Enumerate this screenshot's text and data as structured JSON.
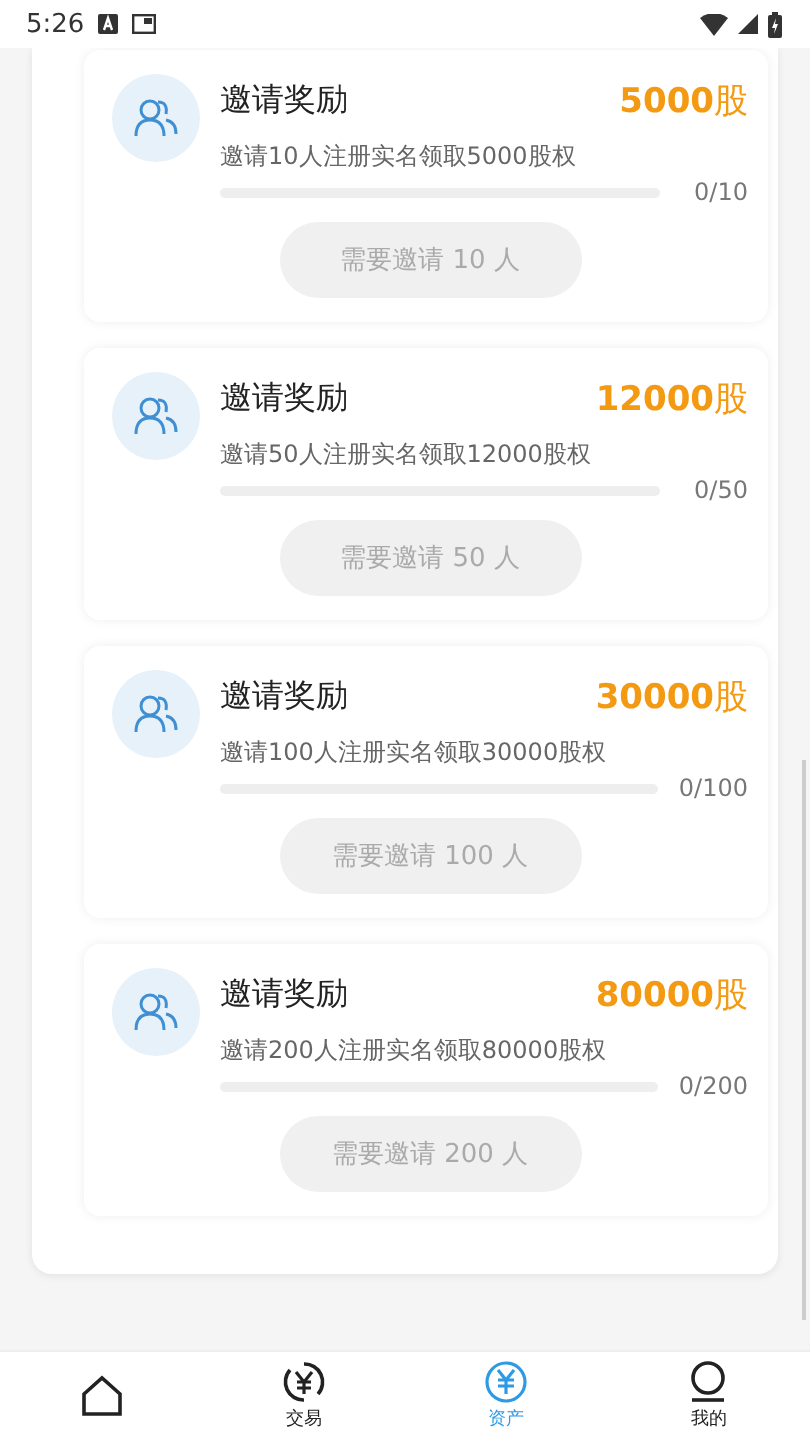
{
  "status_bar": {
    "time": "5:26"
  },
  "rewards": [
    {
      "title": "邀请奖励",
      "amount": "**5000**股",
      "description": "邀请10人注册实名领取5000股权",
      "level": 0,
      "count": "0/10",
      "button": "需要邀请 10 人",
      "disabled": true
    },
    {
      "title": "邀请奖励",
      "amount": "**12000**股",
      "description": "邀请50人注册实名领取12000股权",
      "level": 0,
      "count": "0/50",
      "button": "需要邀请 50 人",
      "disabled": true
    },
    {
      "title": "邀请奖励",
      "amount": "**30000**股",
      "description": "邀请100人注册实名领取30000股权",
      "level": 0,
      "count": "0/100",
      "button": "需要邀请 100 人",
      "disabled": true
    },
    {
      "title": "邀请奖励",
      "amount": "**80000**股",
      "description": "邀请200人注册实名领取80000股权",
      "level": 0,
      "count": "0/200",
      "button": "需要邀请 200 人",
      "disabled": true
    }
  ],
  "tabs": [
    {
      "kind": "home",
      "selected": false
    },
    {
      "kind": "trade",
      "label": "交易",
      "selected": false
    },
    {
      "kind": "assets",
      "label": "资产",
      "selected": true
    },
    {
      "kind": "profile",
      "label": "我的",
      "selected": false
    }
  ]
}
